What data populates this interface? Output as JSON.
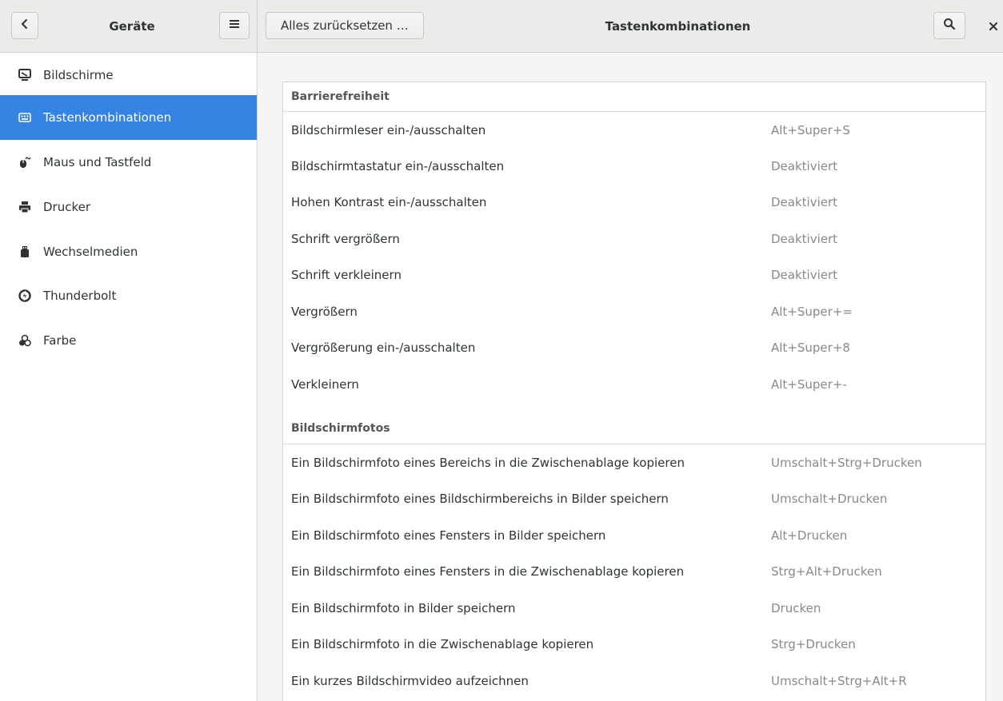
{
  "header": {
    "left_title": "Geräte",
    "reset_label": "Alles zurücksetzen …",
    "title": "Tastenkombinationen"
  },
  "sidebar": {
    "items": [
      {
        "label": "Bildschirme",
        "icon": "display-icon"
      },
      {
        "label": "Tastenkombinationen",
        "icon": "keyboard-icon",
        "selected": true
      },
      {
        "label": "Maus und Tastfeld",
        "icon": "mouse-icon"
      },
      {
        "label": "Drucker",
        "icon": "printer-icon"
      },
      {
        "label": "Wechselmedien",
        "icon": "usb-drive-icon"
      },
      {
        "label": "Thunderbolt",
        "icon": "thunderbolt-icon"
      },
      {
        "label": "Farbe",
        "icon": "color-icon"
      }
    ]
  },
  "sections": [
    {
      "title": "Barrierefreiheit",
      "rows": [
        {
          "label": "Bildschirmleser ein-/ausschalten",
          "accel": "Alt+Super+S"
        },
        {
          "label": "Bildschirmtastatur ein-/ausschalten",
          "accel": "Deaktiviert"
        },
        {
          "label": "Hohen Kontrast ein-/ausschalten",
          "accel": "Deaktiviert"
        },
        {
          "label": "Schrift vergrößern",
          "accel": "Deaktiviert"
        },
        {
          "label": "Schrift verkleinern",
          "accel": "Deaktiviert"
        },
        {
          "label": "Vergrößern",
          "accel": "Alt+Super+="
        },
        {
          "label": "Vergrößerung ein-/ausschalten",
          "accel": "Alt+Super+8"
        },
        {
          "label": "Verkleinern",
          "accel": "Alt+Super+-"
        }
      ]
    },
    {
      "title": "Bildschirmfotos",
      "rows": [
        {
          "label": "Ein Bildschirmfoto eines Bereichs in die Zwischenablage kopieren",
          "accel": "Umschalt+Strg+Drucken"
        },
        {
          "label": "Ein Bildschirmfoto eines Bildschirmbereichs in Bilder speichern",
          "accel": "Umschalt+Drucken"
        },
        {
          "label": "Ein Bildschirmfoto eines Fensters in Bilder speichern",
          "accel": "Alt+Drucken"
        },
        {
          "label": "Ein Bildschirmfoto eines Fensters in die Zwischenablage kopieren",
          "accel": "Strg+Alt+Drucken"
        },
        {
          "label": "Ein Bildschirmfoto in Bilder speichern",
          "accel": "Drucken"
        },
        {
          "label": "Ein Bildschirmfoto in die Zwischenablage kopieren",
          "accel": "Strg+Drucken"
        },
        {
          "label": "Ein kurzes Bildschirmvideo aufzeichnen",
          "accel": "Umschalt+Strg+Alt+R"
        }
      ]
    }
  ]
}
